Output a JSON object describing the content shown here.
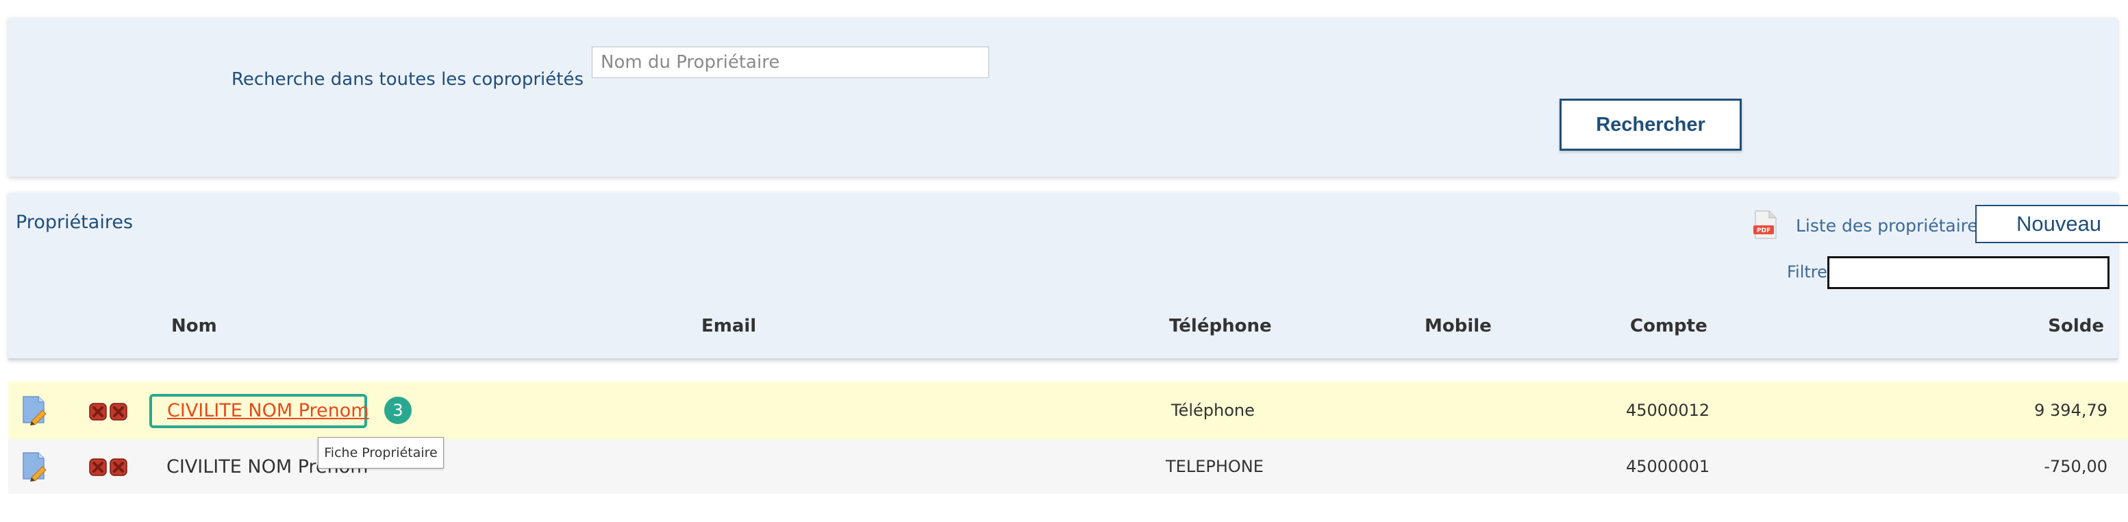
{
  "search": {
    "label": "Recherche dans toutes les copropriétés",
    "placeholder": "Nom du Propriétaire",
    "value": "",
    "button_label": "Rechercher"
  },
  "owners": {
    "title": "Propriétaires",
    "pdf_link_label": "Liste des propriétaires",
    "pdf_icon": "pdf-file-icon",
    "new_button_label": "Nouveau",
    "filter_label": "Filtre",
    "filter_value": ""
  },
  "table": {
    "columns": [
      "Nom",
      "Email",
      "Téléphone",
      "Mobile",
      "Compte",
      "Solde"
    ],
    "rows": [
      {
        "nom": "CIVILITE NOM Prenom",
        "email": "",
        "telephone": "Téléphone",
        "mobile": "",
        "compte": "45000012",
        "solde": "9 394,79"
      },
      {
        "nom": "CIVILITE NOM Prenom",
        "email": "",
        "telephone": "TELEPHONE",
        "mobile": "",
        "compte": "45000001",
        "solde": "-750,00"
      }
    ]
  },
  "tutorial": {
    "step_number": "3",
    "tooltip": "Fiche Propriétaire"
  },
  "colors": {
    "panel_bg": "#ebf1f9",
    "brand_blue": "#1f4e79",
    "highlight_row": "#fefcd3",
    "link_orange": "#e8491d",
    "step_teal": "#2aa88f"
  }
}
